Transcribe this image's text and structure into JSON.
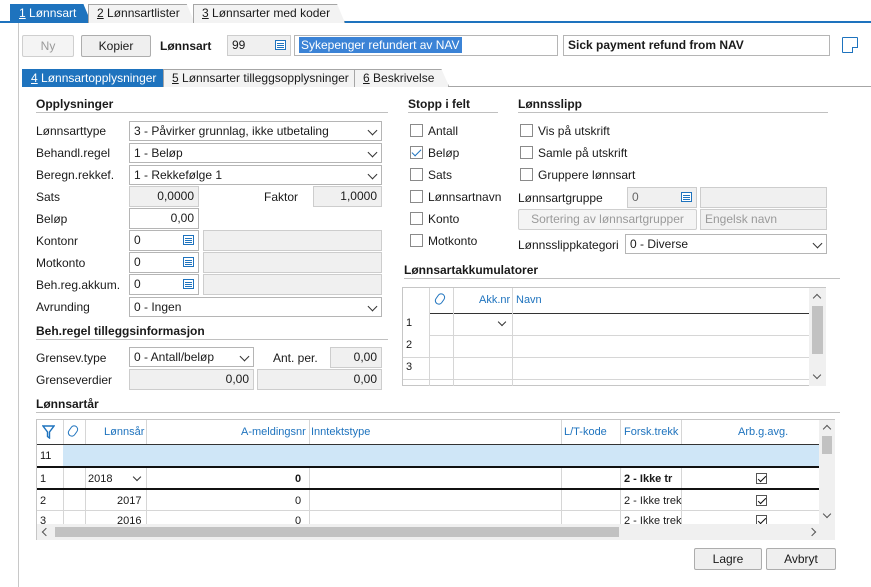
{
  "top_tabs": [
    {
      "key": "1",
      "label": "Lønnsart"
    },
    {
      "key": "2",
      "label": "Lønnsartlister"
    },
    {
      "key": "3",
      "label": "Lønnsarter med koder"
    }
  ],
  "header": {
    "new_label": "Ny",
    "copy_label": "Kopier",
    "lonnsart_label": "Lønnsart",
    "lonnsart_number": "99",
    "name_no": "Sykepenger refundert av NAV",
    "name_en": "Sick payment refund from NAV"
  },
  "sub_tabs": [
    {
      "key": "4",
      "label": "Lønnsartopplysninger"
    },
    {
      "key": "5",
      "label": "Lønnsarter tilleggsopplysninger"
    },
    {
      "key": "6",
      "label": "Beskrivelse"
    }
  ],
  "opplysninger": {
    "title": "Opplysninger",
    "lonnsarttype_label": "Lønnsarttype",
    "lonnsarttype_value": "3 - Påvirker grunnlag, ikke utbetaling",
    "behandlregel_label": "Behandl.regel",
    "behandlregel_value": "1 - Beløp",
    "beregnrekkef_label": "Beregn.rekkef.",
    "beregnrekkef_value": "1 - Rekkefølge 1",
    "sats_label": "Sats",
    "sats_value": "0,0000",
    "faktor_label": "Faktor",
    "faktor_value": "1,0000",
    "belop_label": "Beløp",
    "belop_value": "0,00",
    "kontonr_label": "Kontonr",
    "kontonr_value": "0",
    "motkonto_label": "Motkonto",
    "motkonto_value": "0",
    "behreg_label": "Beh.reg.akkum.",
    "behreg_value": "0",
    "avrunding_label": "Avrunding",
    "avrunding_value": "0 - Ingen"
  },
  "tillegg": {
    "title": "Beh.regel tilleggsinformasjon",
    "grensevtype_label": "Grensev.type",
    "grensevtype_value": "0 - Antall/beløp",
    "antper_label": "Ant. per.",
    "antper_value": "0,00",
    "grenseverdier_label": "Grenseverdier",
    "grenseverdi1": "0,00",
    "grenseverdi2": "0,00"
  },
  "stopp": {
    "title": "Stopp i felt",
    "items": [
      {
        "label": "Antall",
        "checked": false
      },
      {
        "label": "Beløp",
        "checked": true
      },
      {
        "label": "Sats",
        "checked": false
      },
      {
        "label": "Lønnsartnavn",
        "checked": false
      },
      {
        "label": "Konto",
        "checked": false
      },
      {
        "label": "Motkonto",
        "checked": false
      }
    ]
  },
  "lonnsslipp": {
    "title": "Lønnsslipp",
    "vis_label": "Vis på utskrift",
    "samle_label": "Samle på utskrift",
    "gruppere_label": "Gruppere lønnsart",
    "gruppe_label": "Lønnsartgruppe",
    "gruppe_value": "0",
    "sortering_label": "Sortering av lønnsartgrupper",
    "engelsk_placeholder": "Engelsk navn",
    "kategori_label": "Lønnsslippkategori",
    "kategori_value": "0 - Diverse"
  },
  "akkumulatorer": {
    "title": "Lønnsartakkumulatorer",
    "col_akknr": "Akk.nr",
    "col_navn": "Navn",
    "rows": [
      "1",
      "2",
      "3"
    ]
  },
  "lonnsartar": {
    "title": "Lønnsartår",
    "columns": [
      "Lønnsår",
      "A-meldingsnr",
      "Inntektstype",
      "L/T-kode",
      "Forsk.trekk",
      "Arb.g.avg."
    ],
    "filter_row": "11",
    "rows": [
      {
        "num": "1",
        "year": "2018",
        "amelding": "0",
        "forsk": "2 - Ikke tr",
        "arbg": true
      },
      {
        "num": "2",
        "year": "2017",
        "amelding": "0",
        "forsk": "2 - Ikke trek",
        "arbg": true
      },
      {
        "num": "3",
        "year": "2016",
        "amelding": "0",
        "forsk": "2 - Ikke trek",
        "arbg": true
      }
    ]
  },
  "footer": {
    "lagre_label": "Lagre",
    "avbryt_label": "Avbryt"
  },
  "colors": {
    "accent": "#1e73be",
    "selection": "#3b83d6",
    "filter_row": "#cfe6f7"
  }
}
